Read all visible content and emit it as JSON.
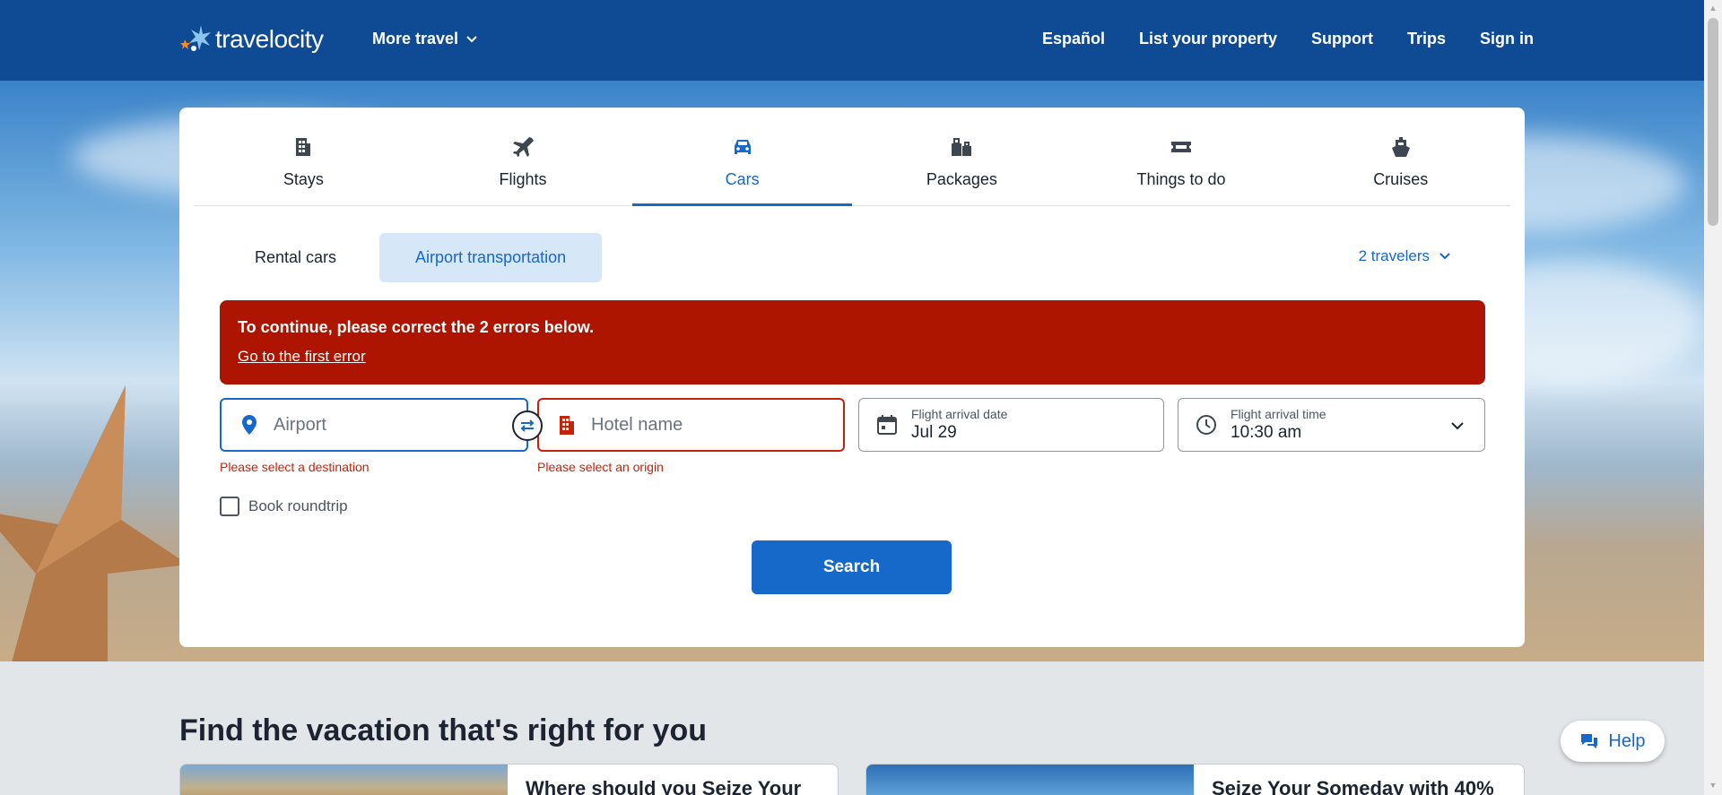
{
  "header": {
    "logo_text": "travelocity",
    "more_travel": "More travel",
    "nav": [
      "Español",
      "List your property",
      "Support",
      "Trips",
      "Sign in"
    ]
  },
  "tabs": [
    {
      "label": "Stays",
      "icon": "building-icon"
    },
    {
      "label": "Flights",
      "icon": "plane-icon"
    },
    {
      "label": "Cars",
      "icon": "car-icon",
      "active": true
    },
    {
      "label": "Packages",
      "icon": "luggage-icon"
    },
    {
      "label": "Things to do",
      "icon": "ticket-icon"
    },
    {
      "label": "Cruises",
      "icon": "ship-icon"
    }
  ],
  "subtabs": {
    "rental": "Rental cars",
    "airport": "Airport transportation"
  },
  "travelers": "2 travelers",
  "error_banner": {
    "title": "To continue, please correct the 2 errors below.",
    "link": "Go to the first error"
  },
  "fields": {
    "airport_placeholder": "Airport",
    "airport_error": "Please select a destination",
    "hotel_placeholder": "Hotel name",
    "hotel_error": "Please select an origin",
    "date_label": "Flight arrival date",
    "date_value": "Jul 29",
    "time_label": "Flight arrival time",
    "time_value": "10:30 am"
  },
  "roundtrip_label": "Book roundtrip",
  "search_label": "Search",
  "section_title": "Find the vacation that's right for you",
  "promos": [
    "Where should you Seize Your",
    "Seize Your Someday with 40%"
  ],
  "help_label": "Help",
  "colors": {
    "header_bg": "#0f4a95",
    "accent": "#1668c9",
    "error": "#ad1500"
  }
}
